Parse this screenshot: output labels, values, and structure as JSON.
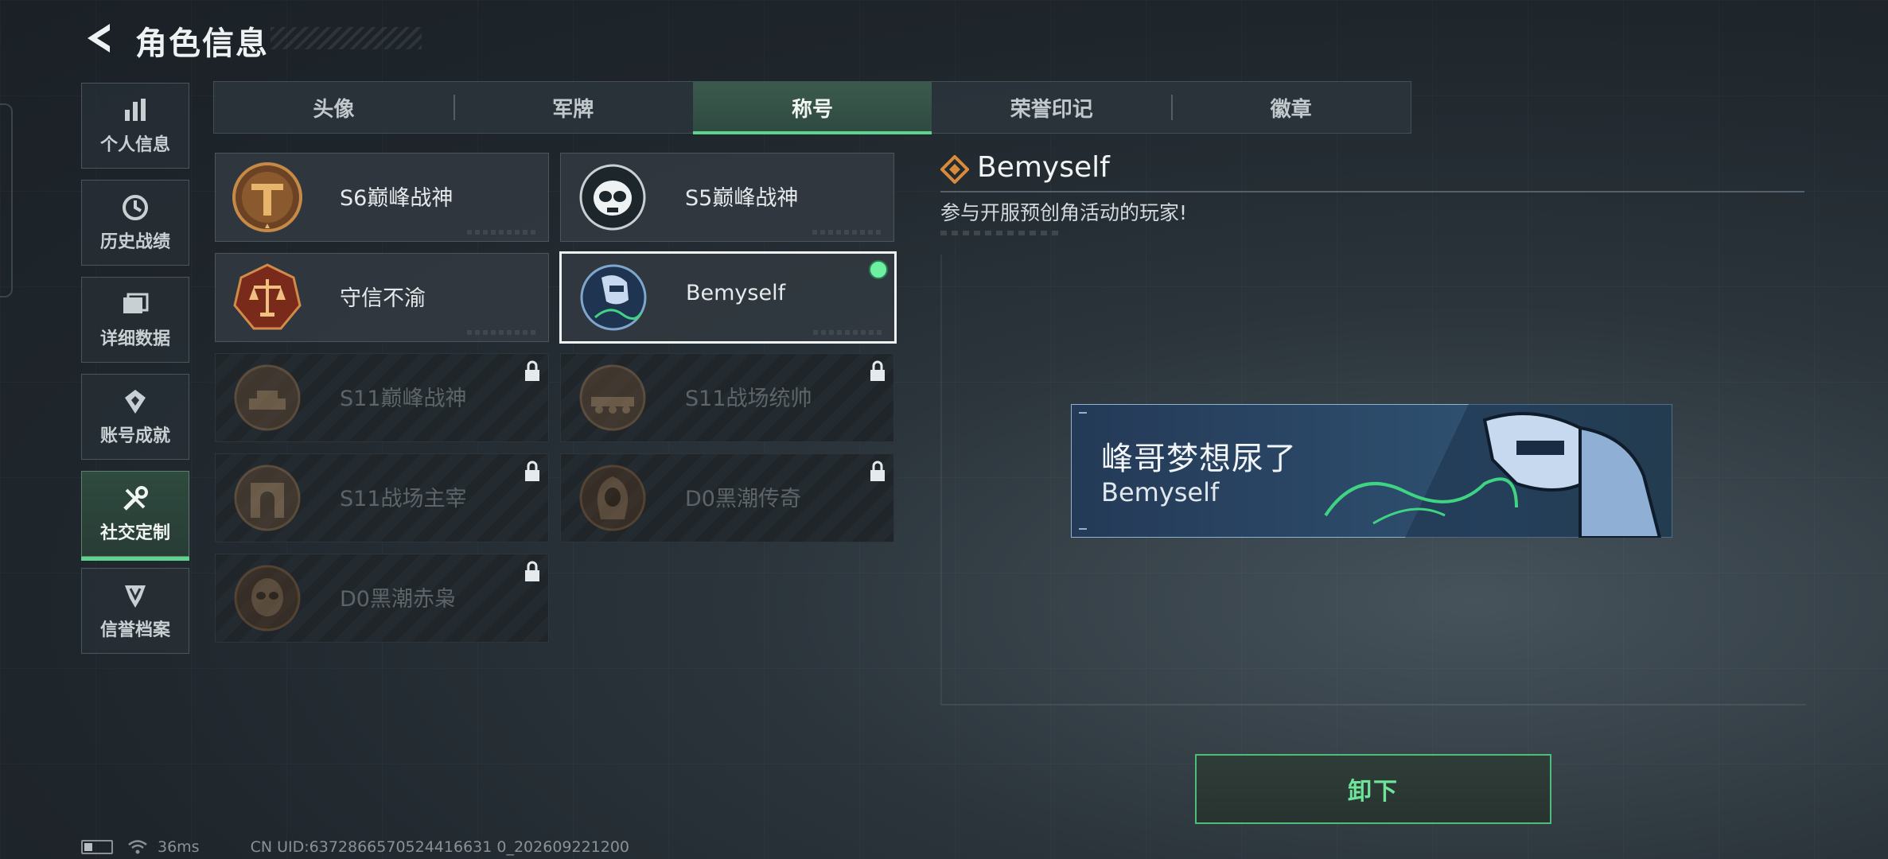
{
  "header": {
    "title": "角色信息"
  },
  "nav": [
    {
      "label": "个人信息",
      "icon": "bar-chart-icon"
    },
    {
      "label": "历史战绩",
      "icon": "history-clock-icon"
    },
    {
      "label": "详细数据",
      "icon": "folder-icon"
    },
    {
      "label": "账号成就",
      "icon": "achievement-icon"
    },
    {
      "label": "社交定制",
      "icon": "tools-icon",
      "active": true
    },
    {
      "label": "信誉档案",
      "icon": "reputation-shield-icon"
    }
  ],
  "tabs": [
    {
      "label": "头像"
    },
    {
      "label": "军牌"
    },
    {
      "label": "称号",
      "active": true
    },
    {
      "label": "荣誉印记"
    },
    {
      "label": "徽章"
    }
  ],
  "titles": [
    {
      "name": "S6巅峰战神",
      "locked": false
    },
    {
      "name": "S5巅峰战神",
      "locked": false
    },
    {
      "name": "守信不渝",
      "locked": false
    },
    {
      "name": "Bemyself",
      "locked": false,
      "selected": true,
      "equipped": true
    },
    {
      "name": "S11巅峰战神",
      "locked": true
    },
    {
      "name": "S11战场统帅",
      "locked": true
    },
    {
      "name": "S11战场主宰",
      "locked": true
    },
    {
      "name": "D0黑潮传奇",
      "locked": true
    },
    {
      "name": "D0黑潮赤枭",
      "locked": true
    }
  ],
  "detail": {
    "name": "Bemyself",
    "description": "参与开服预创角活动的玩家!",
    "banner_title": "峰哥梦想尿了",
    "banner_subtitle": "Bemyself",
    "accent": "#d98a3a"
  },
  "action": {
    "unequip_label": "卸下"
  },
  "status": {
    "ping": "36ms",
    "uid": "CN UID:6372866570524416631 0_202609221200"
  },
  "colors": {
    "accent_green": "#5ed38f",
    "background": "#1e252b"
  }
}
